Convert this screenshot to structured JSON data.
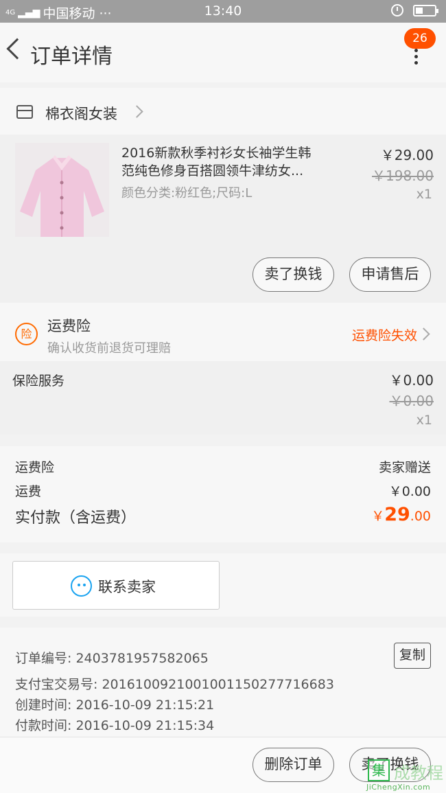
{
  "status_bar": {
    "network": "4G",
    "carrier": "中国移动 ···",
    "time": "13:40"
  },
  "nav": {
    "title": "订单详情",
    "badge_count": "26"
  },
  "shop": {
    "name": "棉衣阁女装"
  },
  "product": {
    "title_line1": "2016新款秋季衬衫女长袖学生韩",
    "title_line2": "范纯色修身百搭圆领牛津纺女...",
    "sku": "颜色分类:粉红色;尺码:L",
    "price": "￥29.00",
    "original_price": "￥198.00",
    "quantity": "x1",
    "image_color": "#f0c6dc"
  },
  "actions": {
    "resell": "卖了换钱",
    "after_sale": "申请售后",
    "delete_order": "删除订单"
  },
  "insurance": {
    "icon_text": "险",
    "title": "运费险",
    "subtitle": "确认收货前退货可理赔",
    "status": "运费险失效"
  },
  "service": {
    "name": "保险服务",
    "price": "￥0.00",
    "original_price": "￥0.00",
    "quantity": "x1"
  },
  "summary": {
    "insurance_label": "运费险",
    "insurance_value": "卖家赠送",
    "shipping_label": "运费",
    "shipping_value": "￥0.00",
    "total_label": "实付款（含运费）",
    "total_currency": "￥",
    "total_integer": "29",
    "total_decimal": ".00"
  },
  "contact": {
    "label": "联系卖家"
  },
  "order_info": {
    "order_no": "订单编号: 2403781957582065",
    "copy_label": "复制",
    "alipay_no": "支付宝交易号: 2016100921001001150277716683",
    "created": "创建时间: 2016-10-09 21:15:21",
    "paid": "付款时间: 2016-10-09 21:15:34"
  },
  "watermark": {
    "logo_char": "集",
    "text_cn": "成教程",
    "text_en": "JiChengXin.com"
  },
  "colors": {
    "accent": "#ff5000",
    "link_blue": "#1aa3f0"
  }
}
